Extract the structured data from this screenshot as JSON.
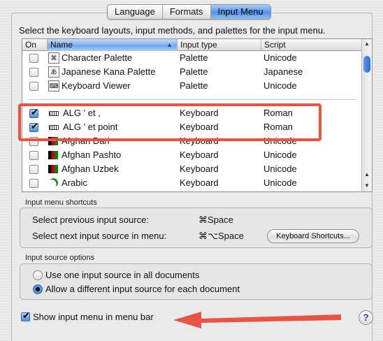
{
  "tabs": [
    {
      "label": "Language",
      "selected": false
    },
    {
      "label": "Formats",
      "selected": false
    },
    {
      "label": "Input Menu",
      "selected": true
    }
  ],
  "instructions": "Select the keyboard layouts, input methods, and palettes for the input menu.",
  "table": {
    "headers": {
      "on": "On",
      "name": "Name",
      "type": "Input type",
      "script": "Script"
    },
    "rows": [
      {
        "checked": false,
        "icon": "character-palette-icon",
        "name": "Character Palette",
        "type": "Palette",
        "script": "Unicode"
      },
      {
        "checked": false,
        "icon": "kana-palette-icon",
        "name": "Japanese Kana Palette",
        "type": "Palette",
        "script": "Japanese"
      },
      {
        "checked": false,
        "icon": "keyboard-viewer-icon",
        "name": "Keyboard Viewer",
        "type": "Palette",
        "script": "Unicode"
      },
      {
        "checked": true,
        "icon": "keyboard-layout-icon",
        "name": "ALG ' et ,",
        "type": "Keyboard",
        "script": "Roman"
      },
      {
        "checked": true,
        "icon": "keyboard-layout-icon",
        "name": "ALG ' et point",
        "type": "Keyboard",
        "script": "Roman"
      },
      {
        "checked": false,
        "icon": "afghan-flag-icon",
        "name": "Afghan Dari",
        "type": "Keyboard",
        "script": "Unicode"
      },
      {
        "checked": false,
        "icon": "afghan-flag-icon",
        "name": "Afghan Pashto",
        "type": "Keyboard",
        "script": "Unicode"
      },
      {
        "checked": false,
        "icon": "afghan-flag-icon",
        "name": "Afghan Uzbek",
        "type": "Keyboard",
        "script": "Unicode"
      },
      {
        "checked": false,
        "icon": "crescent-icon",
        "name": "Arabic",
        "type": "Keyboard",
        "script": "Unicode"
      }
    ]
  },
  "shortcuts": {
    "title": "Input menu shortcuts",
    "prev_label": "Select previous input source:",
    "prev_key": "⌘Space",
    "next_label": "Select next input source in menu:",
    "next_key": "⌘⌥Space",
    "button": "Keyboard Shortcuts..."
  },
  "options": {
    "title": "Input source options",
    "radio1": "Use one input source in all documents",
    "radio2": "Allow a different input source for each document",
    "selected": 2
  },
  "show_menu": {
    "label": "Show input menu in menu bar",
    "checked": true
  },
  "colors": {
    "annotation": "#e85443",
    "accent": "#4d8fe4"
  }
}
